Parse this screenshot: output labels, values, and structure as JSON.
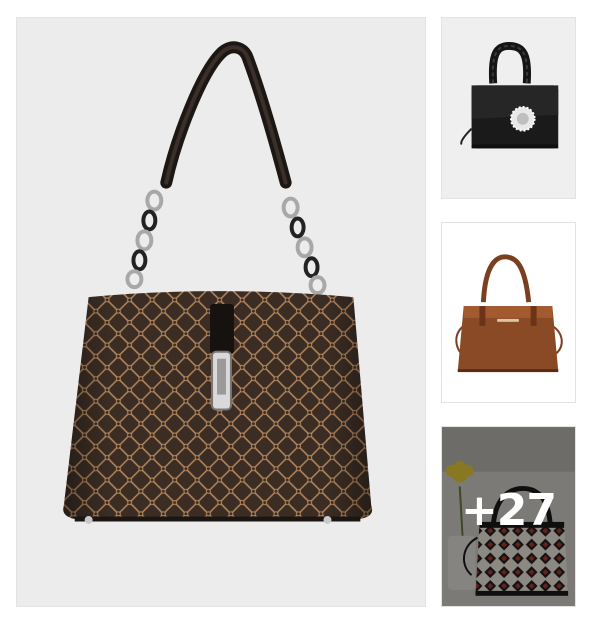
{
  "gallery": {
    "main_image": {
      "icon": "brown-monogram-shoulder-bag"
    },
    "thumbnails": [
      {
        "icon": "black-top-handle-bag"
      },
      {
        "icon": "brown-tote-bag"
      },
      {
        "icon": "patterned-bag",
        "more_count": "+27"
      }
    ]
  },
  "colors": {
    "main_bg": "#ececec",
    "bag_brown": "#3b2d24",
    "pattern_tan": "#b88a5f",
    "black_leather": "#1a1a1a",
    "tan_leather": "#8a4a25",
    "overlay": "rgba(0,0,0,0.42)"
  }
}
